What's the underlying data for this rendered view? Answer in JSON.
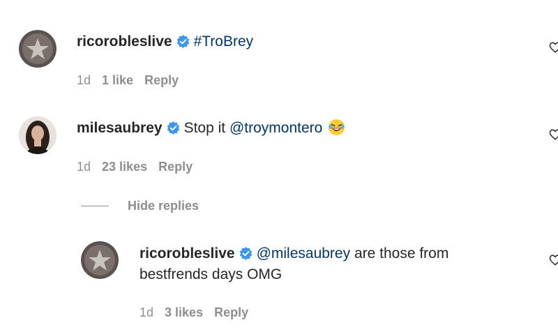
{
  "comments": [
    {
      "username": "ricorobleslive",
      "text_tag": "#TroBrey",
      "time": "1d",
      "likes": "1 like",
      "reply": "Reply"
    },
    {
      "username": "milesaubrey",
      "text": "Stop it",
      "mention": "@troymontero",
      "emoji": "laughing-face-emoji",
      "time": "1d",
      "likes": "23 likes",
      "reply": "Reply"
    }
  ],
  "hide_replies_label": "Hide replies",
  "reply_comment": {
    "username": "ricorobleslive",
    "mention": "@milesaubrey",
    "text_line1": "are those from",
    "text_line2": "bestfrends days OMG",
    "time": "1d",
    "likes": "3 likes",
    "reply": "Reply"
  },
  "colors": {
    "verified": "#3897f0",
    "mention": "#00376b",
    "meta": "#8e8e8e"
  }
}
